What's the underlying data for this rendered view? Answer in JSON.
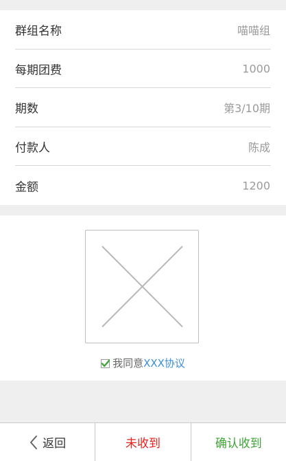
{
  "info": {
    "rows": [
      {
        "label": "群组名称",
        "value": "喵喵组"
      },
      {
        "label": "每期团费",
        "value": "1000"
      },
      {
        "label": "期数",
        "value": "第3/10期"
      },
      {
        "label": "付款人",
        "value": "陈成"
      },
      {
        "label": "金额",
        "value": "1200"
      }
    ]
  },
  "image": {
    "icon": "image-placeholder-icon"
  },
  "agreement": {
    "checked": true,
    "text": "我同意",
    "link": "XXX协议"
  },
  "bottom_bar": {
    "back_label": "返回",
    "not_received_label": "未收到",
    "confirm_label": "确认收到"
  },
  "colors": {
    "background": "#efefef",
    "link": "#3a8fe0",
    "not_received": "#e8231e",
    "confirm": "#3fa536",
    "checkbox": "#3fa536"
  }
}
